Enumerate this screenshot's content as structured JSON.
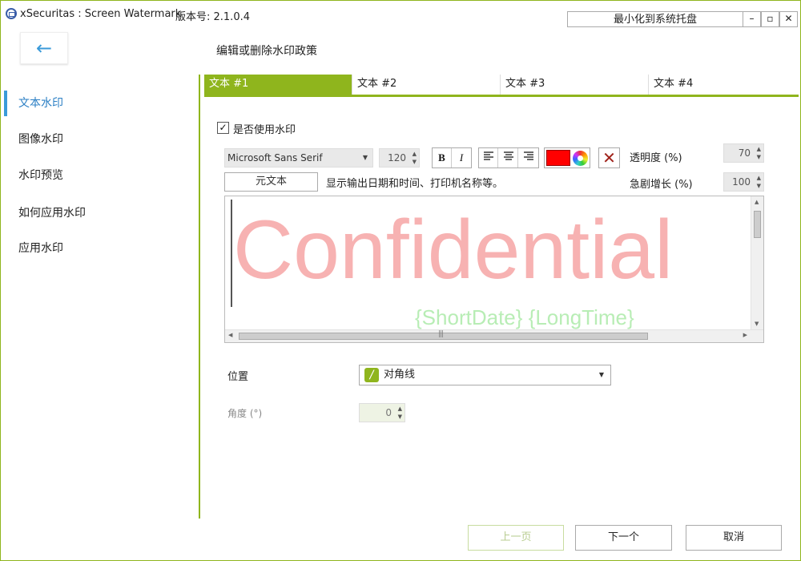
{
  "window": {
    "title": "xSecuritas : Screen Watermark",
    "version": "版本号: 2.1.0.4",
    "tray_button": "最小化到系统托盘",
    "min_glyph": "–",
    "max_glyph": "▫",
    "close_glyph": "✕"
  },
  "header": {
    "back_glyph": "←",
    "title": "编辑或删除水印政策"
  },
  "sidebar": {
    "items": [
      {
        "label": "文本水印",
        "active": true
      },
      {
        "label": "图像水印"
      },
      {
        "label": "水印预览"
      },
      {
        "label": "如何应用水印"
      },
      {
        "label": "应用水印"
      }
    ]
  },
  "tabs": [
    {
      "label": "文本 #1",
      "active": true
    },
    {
      "label": "文本 #2"
    },
    {
      "label": "文本 #3"
    },
    {
      "label": "文本 #4"
    }
  ],
  "editor": {
    "use_watermark_label": "是否使用水印",
    "use_watermark_checked": true,
    "check_glyph": "✓",
    "font_family": "Microsoft Sans Serif",
    "font_size": "120",
    "bold_label": "B",
    "italic_label": "I",
    "align_left_glyph": "☰",
    "align_center_glyph": "☰",
    "align_right_glyph": "☰",
    "text_color": "#ff0000",
    "clear_glyph": "✕",
    "opacity_label": "透明度 (%)",
    "opacity_value": "70",
    "meta_button": "元文本",
    "meta_description": "显示输出日期和时间、打印机名称等。",
    "growth_label": "急剧增长 (%)",
    "growth_value": "100",
    "watermark_text": "Confidential",
    "watermark_subtext": "{ShortDate}  {LongTime}",
    "spin_glyph": "▲\n▼",
    "dropdown_glyph": "▼",
    "scroll_up": "▲",
    "scroll_down": "▼",
    "scroll_left": "◀",
    "scroll_right": "▶",
    "grip_glyph": "|||"
  },
  "position": {
    "label": "位置",
    "icon_glyph": "/",
    "value": "对角线",
    "angle_label": "角度 (°)",
    "angle_value": "0"
  },
  "footer": {
    "prev": "上一页",
    "next": "下一个",
    "cancel": "取消"
  },
  "colors": {
    "accent": "#8fb51d",
    "link_blue": "#3a9ad9",
    "watermark_text": "#f7b2b2",
    "watermark_subtext": "#b8edb5"
  }
}
